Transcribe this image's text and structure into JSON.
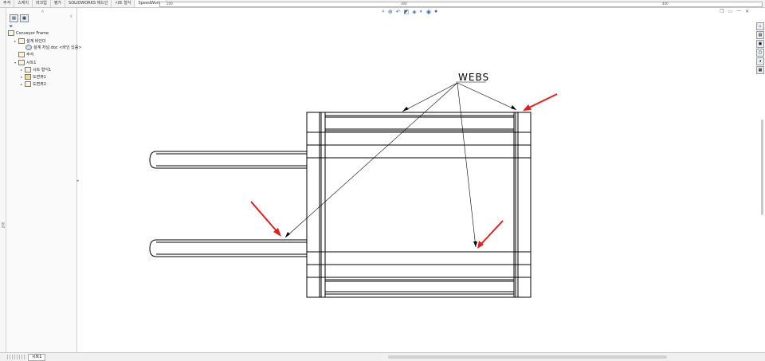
{
  "tabs": [
    {
      "label": "주석"
    },
    {
      "label": "스케치"
    },
    {
      "label": "마크업"
    },
    {
      "label": "평가"
    },
    {
      "label": "SOLIDWORKS 애드인"
    },
    {
      "label": "시트 형식"
    },
    {
      "label": "SpeedWorks"
    }
  ],
  "ruler": {
    "left_mark": "200",
    "mid_mark": "300",
    "right_mark": "400",
    "vertical_mark": "200"
  },
  "tree": {
    "root": "Conveyor Frame",
    "items": [
      {
        "label": "설계 바인더"
      },
      {
        "label": "설계 저널.doc <바인 있음>"
      },
      {
        "label": "주석"
      },
      {
        "label": "시트1"
      },
      {
        "label": "시트 형식1"
      },
      {
        "label": "도면뷰1"
      },
      {
        "label": "도면뷰2"
      }
    ]
  },
  "status": {
    "sheet_tab": "시트1"
  },
  "drawing": {
    "annotation": "WEBS"
  },
  "colors": {
    "annotation_arrow": "#e02020",
    "line": "#000000"
  },
  "icons": [
    "zoom-to-fit-icon",
    "zoom-area-icon",
    "previous-view-icon",
    "section-view-icon",
    "view-orientation-icon",
    "display-style-icon",
    "hide-show-icon",
    "appearance-icon"
  ]
}
